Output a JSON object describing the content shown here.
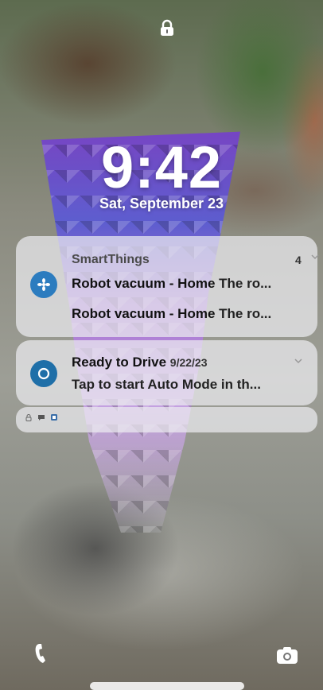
{
  "lockscreen": {
    "time": "9:42",
    "date": "Sat, September 23"
  },
  "notifications": {
    "group": {
      "app_name": "SmartThings",
      "count": "4",
      "items": [
        {
          "title": "Robot vacuum - Home",
          "body": "The ro..."
        },
        {
          "title": "Robot vacuum - Home",
          "body": "The ro..."
        }
      ]
    },
    "drive": {
      "title": "Ready to Drive",
      "date": "9/22/23",
      "body": "Tap to start Auto Mode in th..."
    }
  },
  "icons": {
    "lock": "lock-icon",
    "smartthings": "smartthings-icon",
    "drive": "ready-to-drive-icon",
    "phone": "phone-icon",
    "camera": "camera-icon"
  },
  "colors": {
    "smartthings_blue": "#2c7cbf",
    "drive_blue": "#1f6fa8",
    "card_bg": "rgba(236,236,240,0.72)"
  }
}
